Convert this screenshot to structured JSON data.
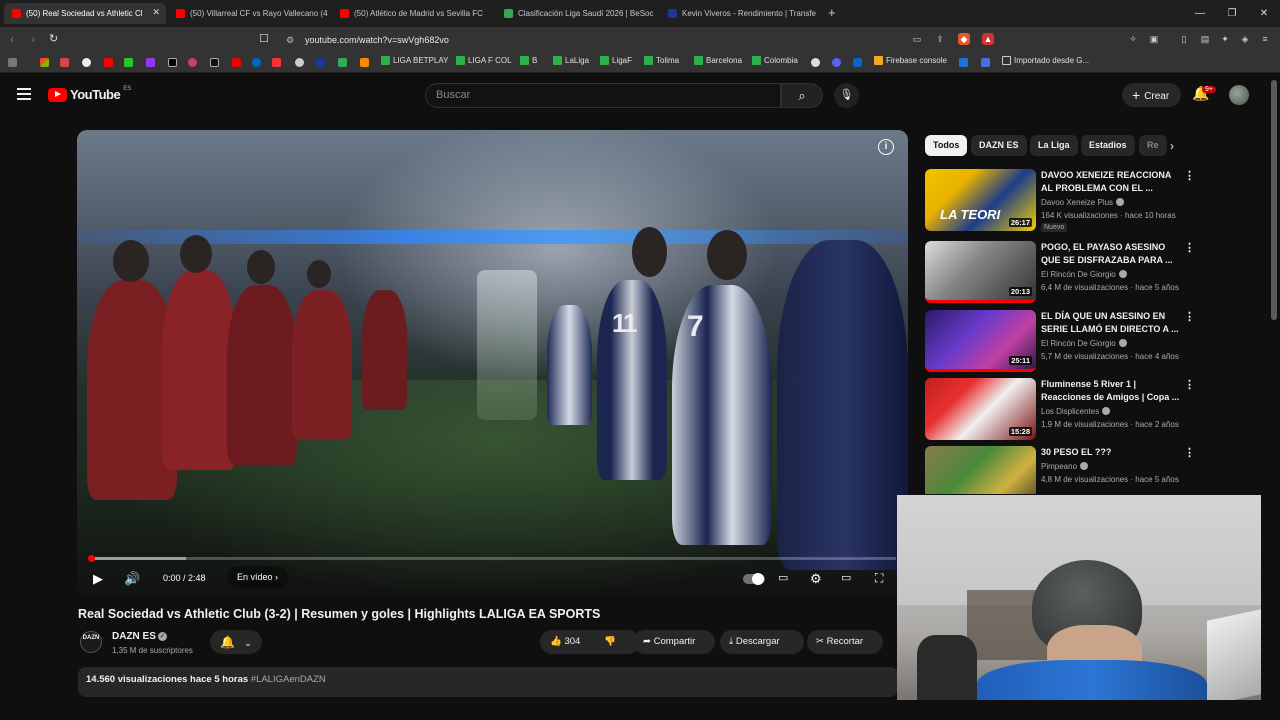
{
  "browser": {
    "tabs": [
      {
        "title": "(50) Real Sociedad vs Athletic Cl",
        "active": true,
        "favicon_color": "#ff0000"
      },
      {
        "title": "(50) Villarreal CF vs Rayo Vallecano (4",
        "active": false,
        "favicon_color": "#ff0000"
      },
      {
        "title": "(50) Atlético de Madrid vs Sevilla FC",
        "active": false,
        "favicon_color": "#ff0000"
      },
      {
        "title": "Clasificación Liga Saudí 2026 | BeSoc",
        "active": false,
        "favicon_color": "#3aa757"
      },
      {
        "title": "Kevin Viveros - Rendimiento | Transfe",
        "active": false,
        "favicon_color": "#1a3a8f"
      }
    ],
    "new_tab": "+",
    "url": "youtube.com/watch?v=swVgh682vo",
    "bookmarks": [
      "LIGA BETPLAY",
      "LIGA F COL",
      "B",
      "LaLiga",
      "LigaF",
      "Tolima",
      "Barcelona",
      "Colombia",
      "Firebase console",
      "Importado desde G..."
    ]
  },
  "youtube": {
    "logo_text": "YouTube",
    "region": "ES",
    "search_placeholder": "Buscar",
    "create_label": "Crear",
    "notifications": "9+"
  },
  "player": {
    "time": "0:00 / 2:48",
    "chapter": "En vídeo",
    "progress_fraction": 0.0,
    "buffer_fraction": 0.12
  },
  "video": {
    "title": "Real Sociedad vs Athletic Club (3-2) | Resumen y goles | Highlights LALIGA EA SPORTS",
    "channel": "DAZN ES",
    "channel_avatar": "DAZN",
    "subscribers": "1,35 M de suscriptores",
    "likes": "304",
    "share": "Compartir",
    "download": "Descargar",
    "clip": "Recortar",
    "views": "14.560 visualizaciones",
    "age": "hace 5 horas",
    "hashtag": "#LALIGAenDAZN"
  },
  "sidebar": {
    "chips": [
      "Todos",
      "DAZN ES",
      "La Liga",
      "Estadios",
      "Re"
    ],
    "recommendations": [
      {
        "title": "DAVOO XENEIZE REACCIONA AL PROBLEMA CON EL ...",
        "channel": "Davoo Xeneize Plus",
        "meta": "164 K visualizaciones · hace 10 horas",
        "duration": "26:17",
        "badge": "Nuevo"
      },
      {
        "title": "POGO, EL PAYASO ASESINO QUE SE DISFRAZABA PARA ...",
        "channel": "El Rincón De Giorgio",
        "meta": "6,4 M de visualizaciones · hace 5 años",
        "duration": "20:13",
        "badge": ""
      },
      {
        "title": "EL DÍA QUE UN ASESINO EN SERIE LLAMÓ EN DIRECTO A ...",
        "channel": "El Rincón De Giorgio",
        "meta": "5,7 M de visualizaciones · hace 4 años",
        "duration": "25:11",
        "badge": ""
      },
      {
        "title": "Fluminense 5 River 1 | Reacciones de Amigos | Copa ...",
        "channel": "Los Displicentes",
        "meta": "1,9 M de visualizaciones · hace 2 años",
        "duration": "15:28",
        "badge": ""
      },
      {
        "title": "30 PESO EL ???",
        "channel": "Pimpeano",
        "meta": "4,8 M de visualizaciones · hace 5 años",
        "duration": "",
        "badge": ""
      }
    ]
  }
}
